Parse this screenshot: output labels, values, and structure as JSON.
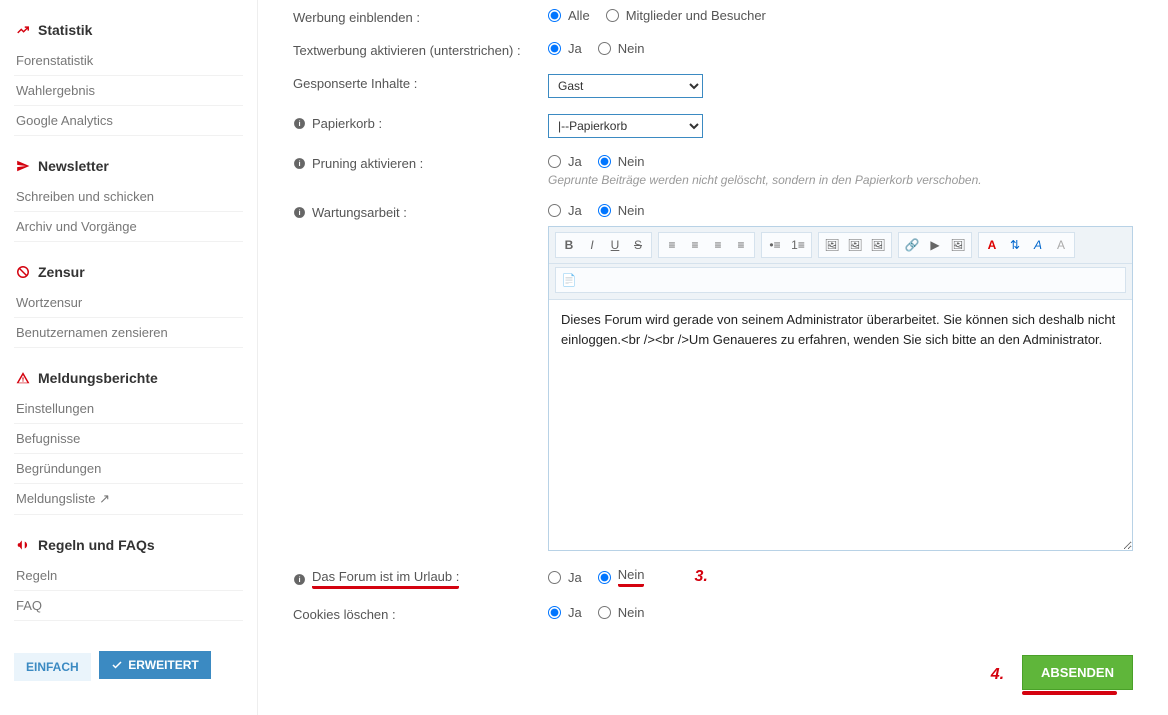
{
  "sidebar": {
    "sections": [
      {
        "icon": "chart",
        "title": "Statistik",
        "items": [
          "Forenstatistik",
          "Wahlergebnis",
          "Google Analytics"
        ]
      },
      {
        "icon": "send",
        "title": "Newsletter",
        "items": [
          "Schreiben und schicken",
          "Archiv und Vorgänge"
        ]
      },
      {
        "icon": "nope",
        "title": "Zensur",
        "items": [
          "Wortzensur",
          "Benutzernamen zensieren"
        ]
      },
      {
        "icon": "warn",
        "title": "Meldungsberichte",
        "items": [
          "Einstellungen",
          "Befugnisse",
          "Begründungen",
          "Meldungsliste ↗"
        ]
      },
      {
        "icon": "horn",
        "title": "Regeln und FAQs",
        "items": [
          "Regeln",
          "FAQ"
        ]
      }
    ],
    "btn_simple": "EINFACH",
    "btn_ext": "ERWEITERT"
  },
  "form": {
    "werbung": {
      "label": "Werbung einblenden :",
      "opts": [
        "Alle",
        "Mitglieder und Besucher"
      ],
      "selected": 0
    },
    "textwerbung": {
      "label": "Textwerbung aktivieren (unterstrichen) :",
      "opts": [
        "Ja",
        "Nein"
      ],
      "selected": 0
    },
    "gesponsert": {
      "label": "Gesponserte Inhalte :",
      "value": "Gast"
    },
    "papierkorb": {
      "label": "Papierkorb :",
      "value": "|--Papierkorb"
    },
    "pruning": {
      "label": "Pruning aktivieren :",
      "opts": [
        "Ja",
        "Nein"
      ],
      "selected": 1,
      "hint": "Geprunte Beiträge werden nicht gelöscht, sondern in den Papierkorb verschoben."
    },
    "wartung": {
      "label": "Wartungsarbeit :",
      "opts": [
        "Ja",
        "Nein"
      ],
      "selected": 1,
      "text": "Dieses Forum wird gerade von seinem Administrator überarbeitet. Sie können sich deshalb nicht einloggen.<br /><br />Um Genaueres zu erfahren, wenden Sie sich bitte an den Administrator."
    },
    "urlaub": {
      "label": "Das Forum ist im Urlaub :",
      "opts": [
        "Ja",
        "Nein"
      ],
      "selected": 1
    },
    "cookies": {
      "label": "Cookies löschen :",
      "opts": [
        "Ja",
        "Nein"
      ],
      "selected": 0
    }
  },
  "annotation": {
    "n3": "3.",
    "n4": "4."
  },
  "submit": "ABSENDEN"
}
